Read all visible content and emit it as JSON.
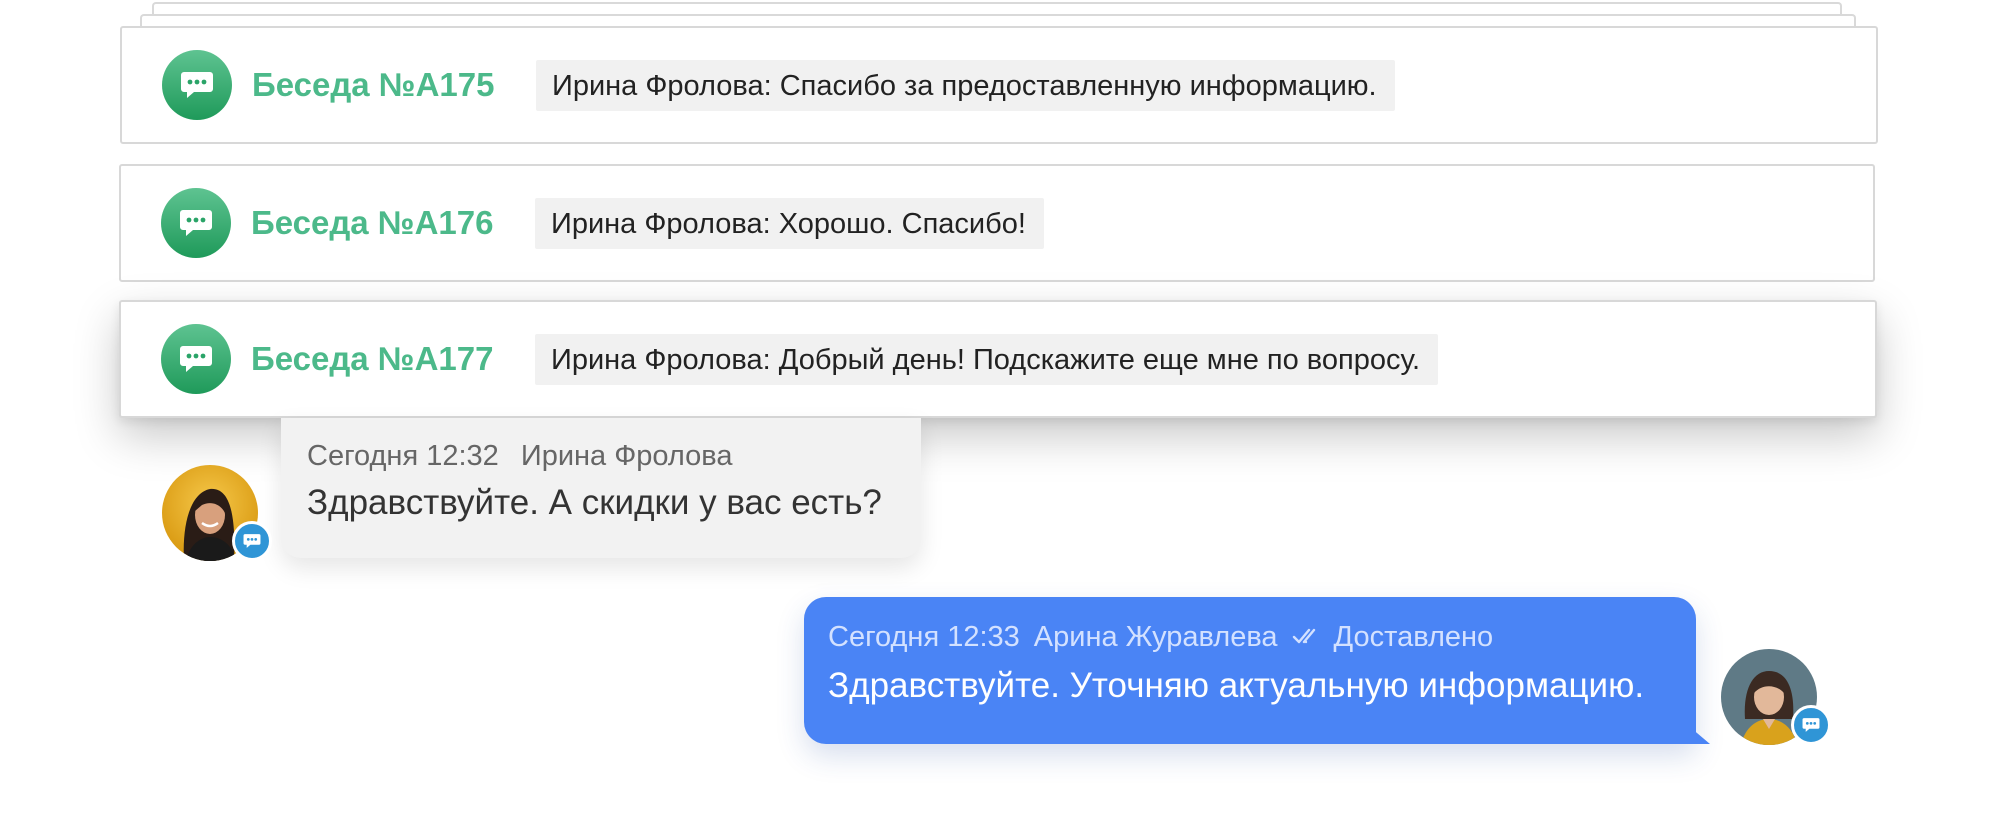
{
  "conversations": [
    {
      "title": "Беседа №А175",
      "preview": "Ирина Фролова: Спасибо за предоставленную информацию."
    },
    {
      "title": "Беседа №А176",
      "preview": "Ирина Фролова: Хорошо. Спасибо!"
    },
    {
      "title": "Беседа №А177",
      "preview": "Ирина Фролова: Добрый день! Подскажите еще мне по вопросу."
    }
  ],
  "messages": {
    "incoming": {
      "time": "Сегодня 12:32",
      "author": "Ирина Фролова",
      "text": "Здравствуйте. А скидки у вас есть?"
    },
    "outgoing": {
      "time": "Сегодня 12:33",
      "author": "Арина Журавлева",
      "status": "Доставлено",
      "text": "Здравствуйте. Уточняю актуальную информацию."
    }
  },
  "icons": {
    "conversation": "chat-bubble-icon",
    "avatar_badge": "chat-bubble-icon",
    "delivered": "double-check-icon"
  },
  "colors": {
    "accent_green": "#4cb98a",
    "outgoing_bubble": "#4a84f5",
    "badge_blue": "#2f95d6"
  }
}
